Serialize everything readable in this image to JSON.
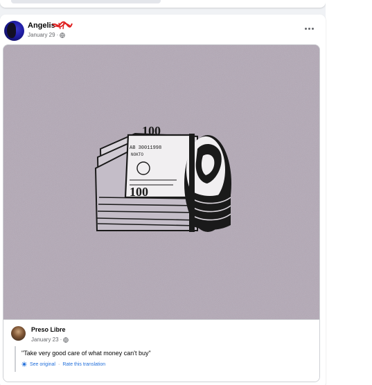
{
  "post": {
    "author_name": "Angelis",
    "date": "January 29",
    "visibility_icon": "globe-icon",
    "more_icon": "more-options-icon"
  },
  "shared_post": {
    "author_name": "Preso Libre",
    "date": "January 23",
    "visibility_icon": "globe-icon",
    "quote": "\"Take very good care of what money can't buy\"",
    "translation": {
      "icon": "translate-icon",
      "see_original": "See original",
      "separator": "·",
      "rate": "Rate this translation"
    }
  },
  "money_art": {
    "serial": "AB 30011998",
    "denomination": "100",
    "seal_text": "NOKTO"
  },
  "colors": {
    "image_background": "#b3a8b6",
    "link": "#216fdb",
    "muted_text": "#65676b",
    "redaction": "#e02020"
  }
}
